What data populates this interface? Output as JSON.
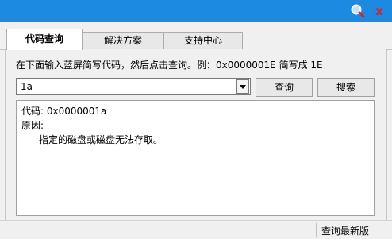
{
  "titlebar": {
    "search_icon": "search-icon",
    "close_label": "x"
  },
  "tabs": [
    {
      "label": "代码查询",
      "active": true
    },
    {
      "label": "解决方案",
      "active": false
    },
    {
      "label": "支持中心",
      "active": false
    }
  ],
  "instruction": "在下面输入蓝屏简写代码，然后点击查询。例：0x0000001E 简写成 1E",
  "code_input": {
    "value": "1a"
  },
  "buttons": {
    "query": "查询",
    "search": "搜索"
  },
  "result": {
    "code_line": "代码: 0x0000001a",
    "reason_label": "原因:",
    "reason_text": "指定的磁盘或磁盘无法存取。"
  },
  "status": {
    "update_link": "查询最新版"
  },
  "colors": {
    "titlebar": "#1c8ae0",
    "close": "#e02020"
  }
}
